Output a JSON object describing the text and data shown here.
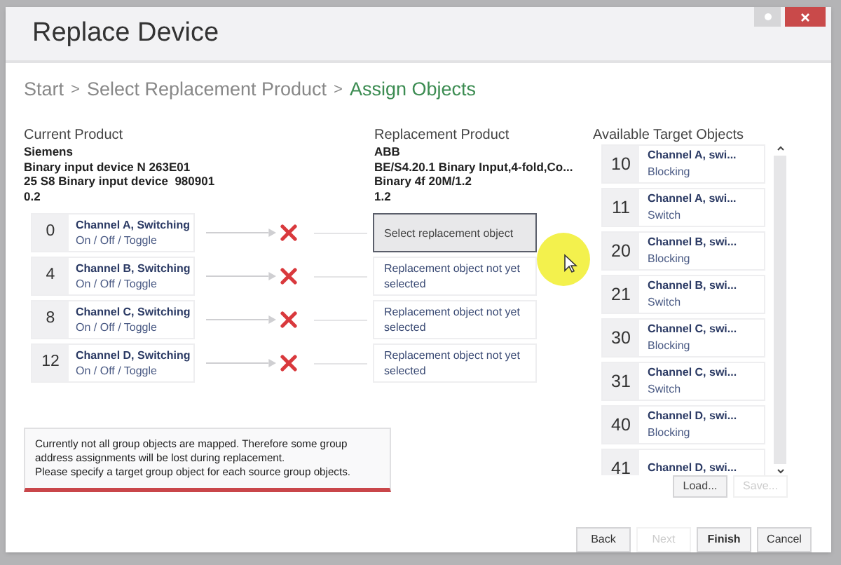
{
  "window": {
    "title": "Replace Device"
  },
  "breadcrumb": [
    {
      "label": "Start",
      "selected": false
    },
    {
      "label": "Select Replacement Product",
      "selected": false
    },
    {
      "label": "Assign Objects",
      "selected": true
    }
  ],
  "breadcrumb_separator": ">",
  "current_product": {
    "heading": "Current Product",
    "lines": [
      "Siemens",
      "Binary input device N 263E01",
      "25 S8 Binary input device  980901",
      "0.2"
    ]
  },
  "replacement_product": {
    "heading": "Replacement Product",
    "lines": [
      "ABB",
      "BE/S4.20.1 Binary Input,4-fold,Co...",
      "Binary 4f 20M/1.2",
      "1.2"
    ]
  },
  "mappings": [
    {
      "number": "0",
      "title": "Channel A, Switching",
      "subtitle": "On / Off / Toggle",
      "mapped": false,
      "target": "Select replacement object",
      "selected": true
    },
    {
      "number": "4",
      "title": "Channel B, Switching",
      "subtitle": "On / Off / Toggle",
      "mapped": false,
      "target": "Replacement object not yet selected",
      "selected": false
    },
    {
      "number": "8",
      "title": "Channel C, Switching",
      "subtitle": "On / Off / Toggle",
      "mapped": false,
      "target": "Replacement object not yet selected",
      "selected": false
    },
    {
      "number": "12",
      "title": "Channel D, Switching",
      "subtitle": "On / Off / Toggle",
      "mapped": false,
      "target": "Replacement object not yet selected",
      "selected": false
    }
  ],
  "targets": {
    "heading": "Available Target Objects",
    "items": [
      {
        "number": "10",
        "title": "Channel A, swi...",
        "subtitle": "Blocking"
      },
      {
        "number": "11",
        "title": "Channel A, swi...",
        "subtitle": "Switch"
      },
      {
        "number": "20",
        "title": "Channel B, swi...",
        "subtitle": "Blocking"
      },
      {
        "number": "21",
        "title": "Channel B, swi...",
        "subtitle": "Switch"
      },
      {
        "number": "30",
        "title": "Channel C, swi...",
        "subtitle": "Blocking"
      },
      {
        "number": "31",
        "title": "Channel C, swi...",
        "subtitle": "Switch"
      },
      {
        "number": "40",
        "title": "Channel D, swi...",
        "subtitle": "Blocking"
      },
      {
        "number": "41",
        "title": "Channel D, swi..."
      }
    ]
  },
  "list_buttons": [
    {
      "label": "Load...",
      "disabled": false
    },
    {
      "label": "Save...",
      "disabled": true
    }
  ],
  "warning": "Currently not all group objects are mapped. Therefore some group address assignments will be lost during replacement.\nPlease specify a target group object for each source group objects.",
  "footer_buttons": [
    {
      "label": "Back",
      "disabled": false,
      "primary": false
    },
    {
      "label": "Next",
      "disabled": true,
      "primary": false
    },
    {
      "label": "Finish",
      "disabled": false,
      "primary": true
    },
    {
      "label": "Cancel",
      "disabled": false,
      "primary": false
    }
  ]
}
